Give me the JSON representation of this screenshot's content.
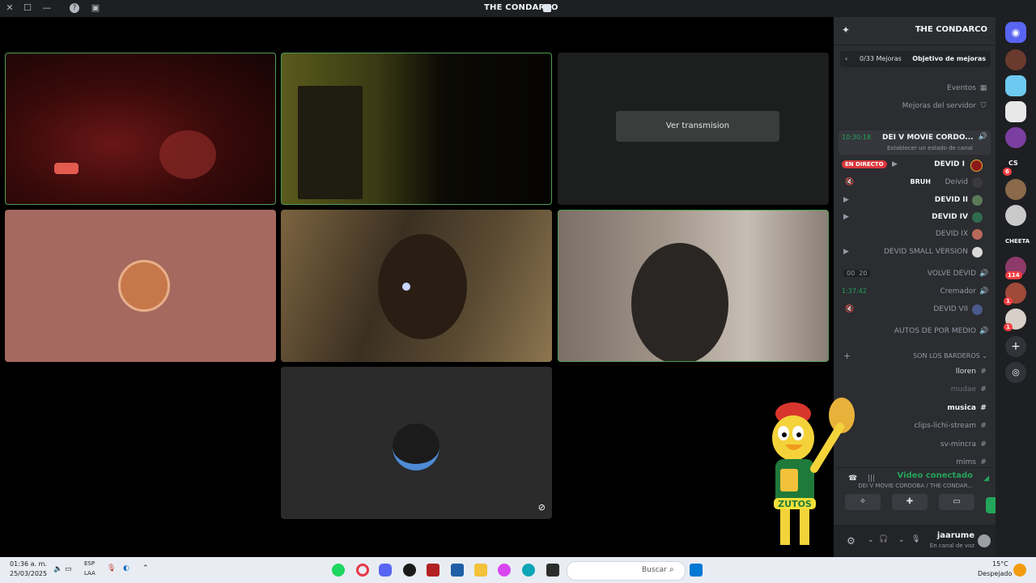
{
  "window": {
    "title": "THE CONDARCO"
  },
  "stage": {
    "stream_button": "Ver transmision"
  },
  "server": {
    "name": "THE CONDARCO",
    "boost_goal": "Objetivo de mejoras",
    "boost_count": "0/33 Mejoras",
    "events": "Eventos",
    "server_boosts": "Mejoras del servidor"
  },
  "voice": {
    "channel1": {
      "name": "DEI V MOVIE CORDO...",
      "timer": "10:30:18",
      "status": "Establecer un estado de canal"
    },
    "users": [
      {
        "name": "DEVID I",
        "live": "EN DIRECTO"
      },
      {
        "name": "Deivid",
        "extra": "BRUH"
      },
      {
        "name": "DEVID II"
      },
      {
        "name": "DEVID IV"
      },
      {
        "name": "DEVID IX"
      },
      {
        "name": "DEVID SMALL VERSION"
      }
    ],
    "channel2": {
      "name": "VOLVE DEVID",
      "count_a": "00",
      "count_b": "20"
    },
    "channel3": {
      "name": "Cremador",
      "timer": "1:37:42"
    },
    "channel3_user": "DEVID VII",
    "channel4": {
      "name": "AUTOS DE POR MEDIO"
    }
  },
  "category": {
    "name": "SON LOS BARDEROS"
  },
  "text_channels": [
    "lloren",
    "mudae",
    "musica",
    "clips-lichi-stream",
    "sv-mincra",
    "mims"
  ],
  "connection": {
    "status": "Video conectado",
    "detail": "DEI V MOVIE CORDOBA / THE CONDAR..."
  },
  "user": {
    "name": "jaarume",
    "status": "En canal de voz"
  },
  "guild_badges": [
    "6",
    "CS",
    "114",
    "1",
    "1"
  ],
  "guild_label": "CHEETA",
  "mascot": {
    "text": "ZUTOS"
  },
  "taskbar": {
    "search": "Buscar",
    "weather_temp": "15°C",
    "weather_desc": "Despejado",
    "lang_a": "ESP",
    "lang_b": "LAA",
    "time": "01:36 a. m.",
    "date": "25/03/2025"
  },
  "colors": {
    "accent_green": "#4f9a55",
    "live_red": "#da373c",
    "connected_green": "#23a55a"
  }
}
